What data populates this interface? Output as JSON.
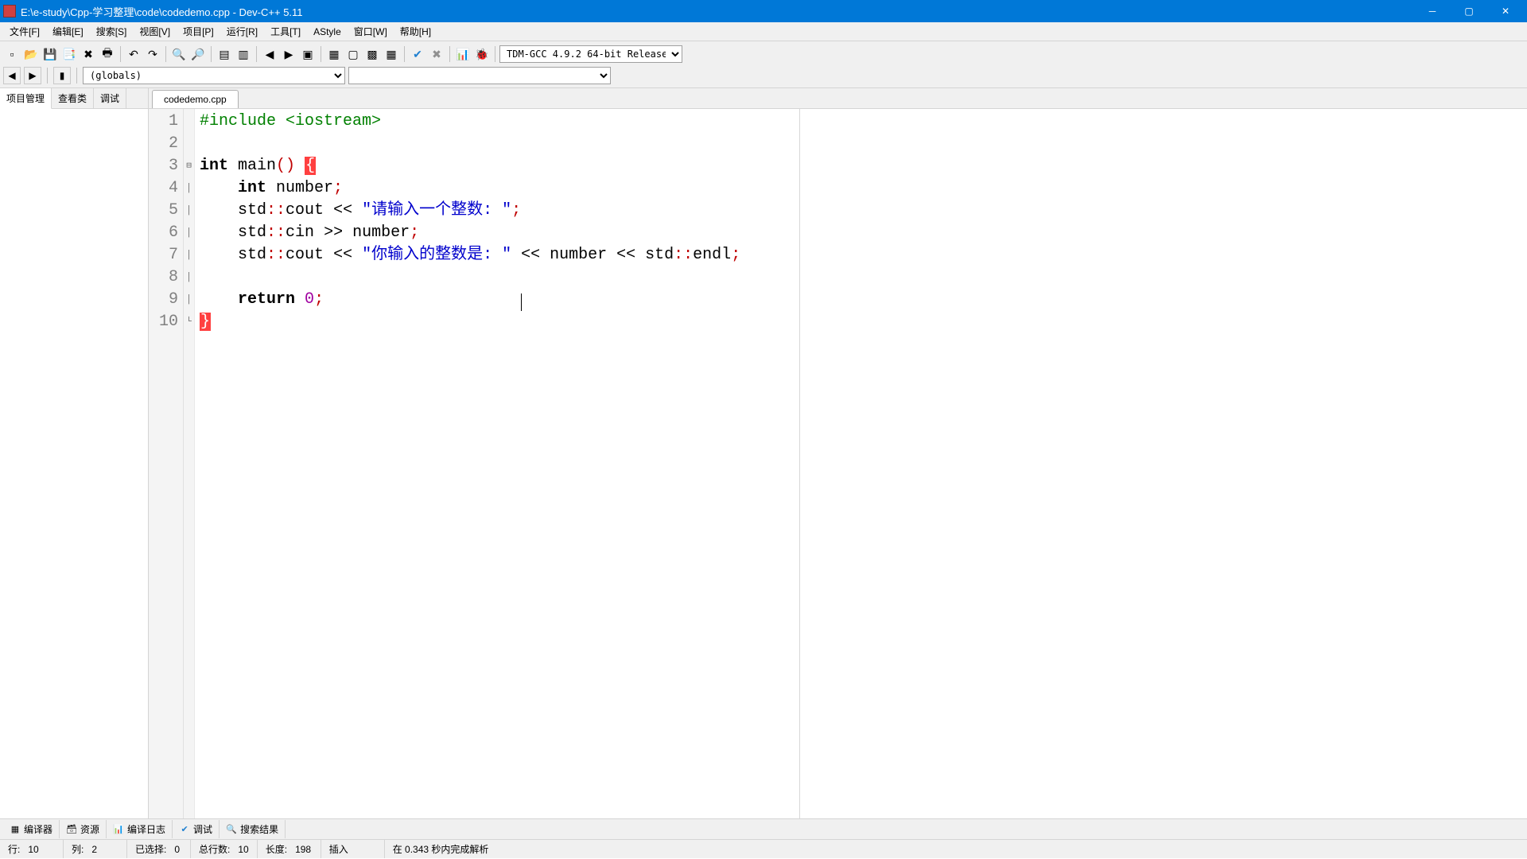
{
  "title": "E:\\e-study\\Cpp-学习整理\\code\\codedemo.cpp - Dev-C++ 5.11",
  "menus": [
    "文件[F]",
    "编辑[E]",
    "搜索[S]",
    "视图[V]",
    "项目[P]",
    "运行[R]",
    "工具[T]",
    "AStyle",
    "窗口[W]",
    "帮助[H]"
  ],
  "compiler": "TDM-GCC 4.9.2 64-bit Release",
  "globals_combo": "(globals)",
  "sidebar_tabs": [
    "项目管理",
    "查看类",
    "调试"
  ],
  "editor_tab": "codedemo.cpp",
  "code": {
    "l1_pp": "#include <iostream>",
    "indent": "    ",
    "kw_int": "int",
    "main_name": " main",
    "paren_open": "(",
    "paren_close": ")",
    "space": " ",
    "brace_open": "{",
    "number_decl": " number",
    "semi": ";",
    "stdcout": "std",
    "dcolon": "::",
    "cout": "cout",
    "lshift": " << ",
    "str1": "\"请输入一个整数: \"",
    "cin": "cin",
    "rshift": " >> ",
    "number_ref": "number",
    "str2": "\"你输入的整数是: \"",
    "endl": "endl",
    "kw_return": "return",
    "zero": "0",
    "brace_close": "}"
  },
  "bottom_tabs": [
    "编译器",
    "资源",
    "编译日志",
    "调试",
    "搜索结果"
  ],
  "status": {
    "line_label": "行:",
    "line_val": "10",
    "col_label": "列:",
    "col_val": "2",
    "sel_label": "已选择:",
    "sel_val": "0",
    "total_label": "总行数:",
    "total_val": "10",
    "len_label": "长度:",
    "len_val": "198",
    "mode": "插入",
    "parse": "在 0.343 秒内完成解析"
  }
}
